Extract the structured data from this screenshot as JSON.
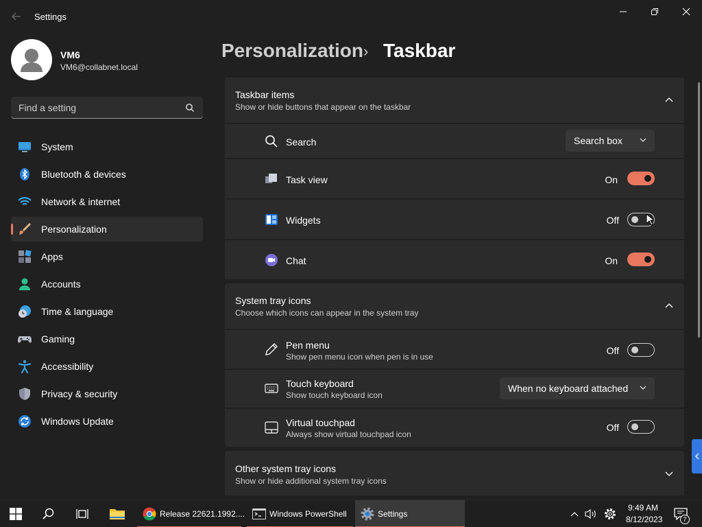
{
  "window": {
    "title": "Settings",
    "controls": [
      "minimize-icon",
      "restore-icon",
      "close-icon"
    ]
  },
  "user": {
    "name": "VM6",
    "email": "VM6@collabnet.local"
  },
  "search": {
    "placeholder": "Find a setting"
  },
  "sidebar": {
    "items": [
      {
        "label": "System",
        "icon": "system-icon"
      },
      {
        "label": "Bluetooth & devices",
        "icon": "bluetooth-icon"
      },
      {
        "label": "Network & internet",
        "icon": "network-icon"
      },
      {
        "label": "Personalization",
        "icon": "personalization-icon",
        "active": true
      },
      {
        "label": "Apps",
        "icon": "apps-icon"
      },
      {
        "label": "Accounts",
        "icon": "accounts-icon"
      },
      {
        "label": "Time & language",
        "icon": "time-language-icon"
      },
      {
        "label": "Gaming",
        "icon": "gaming-icon"
      },
      {
        "label": "Accessibility",
        "icon": "accessibility-icon"
      },
      {
        "label": "Privacy & security",
        "icon": "privacy-icon"
      },
      {
        "label": "Windows Update",
        "icon": "windows-update-icon"
      }
    ]
  },
  "header": {
    "parent": "Personalization",
    "separator": "›",
    "current": "Taskbar"
  },
  "taskbar_items": {
    "title": "Taskbar items",
    "subtitle": "Show or hide buttons that appear on the taskbar",
    "rows": [
      {
        "label": "Search",
        "type": "dropdown",
        "value": "Search box"
      },
      {
        "label": "Task view",
        "type": "toggle",
        "state": "On"
      },
      {
        "label": "Widgets",
        "type": "toggle",
        "state": "Off"
      },
      {
        "label": "Chat",
        "type": "toggle",
        "state": "On"
      }
    ]
  },
  "system_tray": {
    "title": "System tray icons",
    "subtitle": "Choose which icons can appear in the system tray",
    "rows": [
      {
        "label": "Pen menu",
        "sub": "Show pen menu icon when pen is in use",
        "type": "toggle",
        "state": "Off"
      },
      {
        "label": "Touch keyboard",
        "sub": "Show touch keyboard icon",
        "type": "dropdown",
        "value": "When no keyboard attached"
      },
      {
        "label": "Virtual touchpad",
        "sub": "Always show virtual touchpad icon",
        "type": "toggle",
        "state": "Off"
      }
    ]
  },
  "other_tray": {
    "title": "Other system tray icons",
    "subtitle": "Show or hide additional system tray icons"
  },
  "taskbar": {
    "apps": [
      {
        "label": "Release 22621.1992....",
        "icon": "chrome-icon"
      },
      {
        "label": "Windows PowerShell",
        "icon": "powershell-icon"
      },
      {
        "label": "Settings",
        "icon": "settings-gear-icon",
        "active": true
      }
    ],
    "time": "9:49 AM",
    "date": "8/12/2023",
    "notifications": "7"
  },
  "colors": {
    "accent": "#e8775e",
    "background": "#202020",
    "card": "#2b2b2b",
    "taskbar": "#1f1f1f"
  }
}
